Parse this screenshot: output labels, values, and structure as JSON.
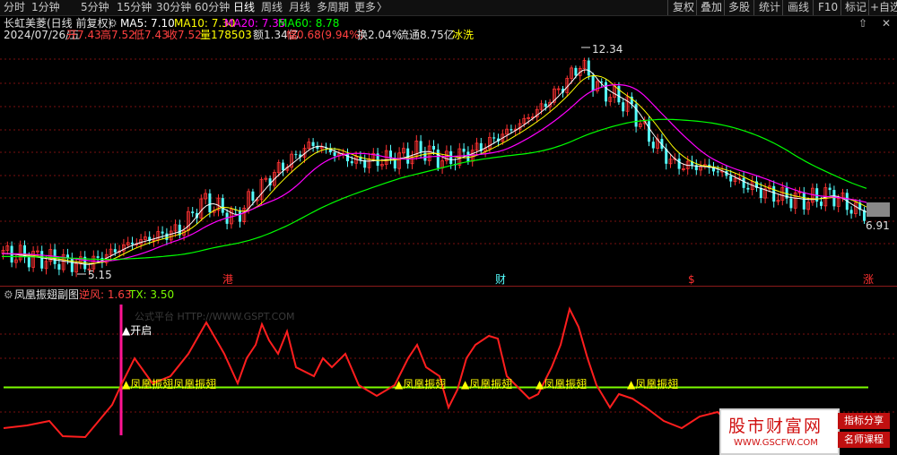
{
  "toolbar": {
    "tabs": [
      "分时",
      "1分钟",
      "5分钟",
      "15分钟",
      "30分钟",
      "60分钟",
      "日线",
      "周线",
      "月线",
      "多周期",
      "更多"
    ],
    "more_arrow": "〉",
    "actions": [
      "复权",
      "叠加",
      "多股",
      "统计",
      "画线",
      "F10",
      "标记",
      "+自选"
    ]
  },
  "stock": {
    "name": "长虹美菱(日线 前复权)",
    "ma5_label": "MA5: 7.10",
    "ma10_label": "MA10: 7.30",
    "ma20_label": "MA20: 7.35",
    "ma60_label": "MA60: 8.78",
    "date": "2024/07/26/五",
    "open": "开7.43",
    "high": "高7.52",
    "low": "低7.43",
    "close": "收7.52",
    "volume": "量178503",
    "amount": "额1.34亿",
    "change": "幅0.68(9.94%)",
    "turnover": "换2.04%",
    "float_cap": "流通8.75亿",
    "tag": "冰洗"
  },
  "price_annotations": {
    "high_price": "12.34",
    "low_price": "5.15",
    "last_price": "6.91"
  },
  "event_markers": [
    "港",
    "财",
    "$",
    "涨"
  ],
  "indicator": {
    "title": "凤凰振翅副图",
    "value1": "逆风: 1.63",
    "value2": "TX: 3.50",
    "watermark": "公式平台 HTTP://WWW.GSPT.COM",
    "open_label": "▲开启",
    "signal_label": "▲凤凰振翅",
    "signal_label_double": "▲凤凰振翅凤凰振翅"
  },
  "site_watermark": {
    "name": "股市财富网",
    "url": "WWW.GSCFW.COM",
    "tag1": "指标分享",
    "tag2": "名师课程"
  },
  "colors": {
    "bg": "#000000",
    "up": "#ff3232",
    "down": "#54fcfc",
    "ma5": "#ffffff",
    "ma10": "#ffff00",
    "ma20": "#ff00ff",
    "ma60": "#00ff00",
    "indicator_line": "#ff1e1e",
    "threshold_line": "#7cfc00",
    "open_marker": "#ff1493"
  }
}
